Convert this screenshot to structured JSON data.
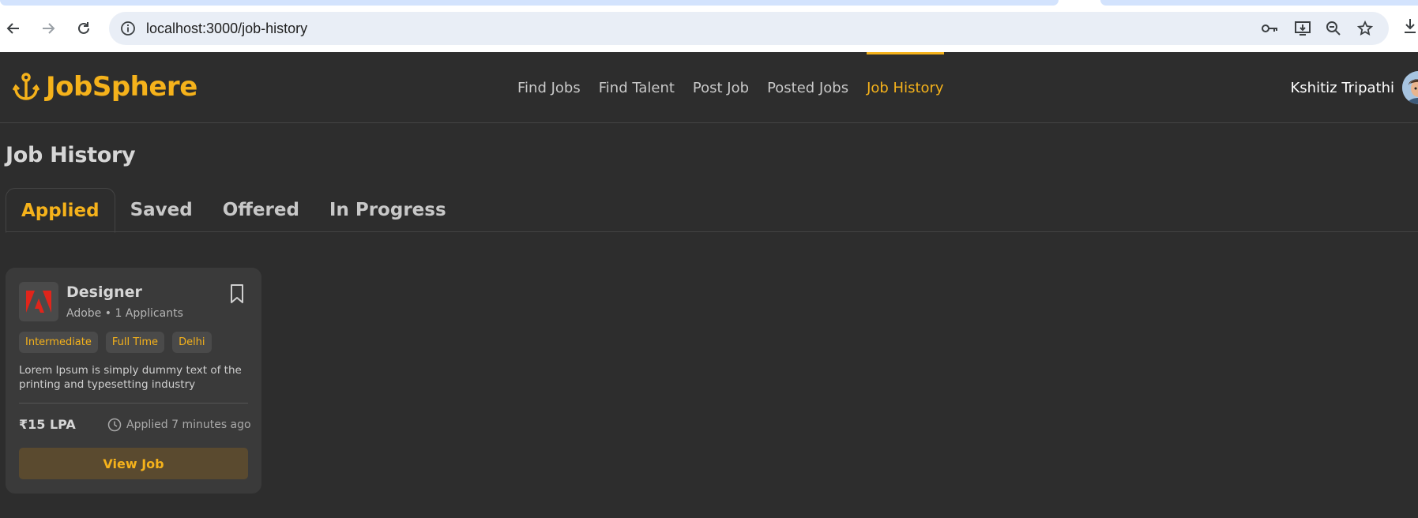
{
  "browser": {
    "url": "localhost:3000/job-history",
    "icons": [
      "back-arrow-icon",
      "forward-arrow-icon",
      "reload-icon",
      "info-icon",
      "key-icon",
      "install-app-icon",
      "zoom-icon",
      "star-icon",
      "download-icon"
    ]
  },
  "header": {
    "brand": "JobSphere",
    "brand_icon": "anchor-icon",
    "nav": [
      {
        "label": "Find Jobs",
        "active": false
      },
      {
        "label": "Find Talent",
        "active": false
      },
      {
        "label": "Post Job",
        "active": false
      },
      {
        "label": "Posted Jobs",
        "active": false
      },
      {
        "label": "Job History",
        "active": true
      }
    ],
    "user_name": "Kshitiz Tripathi"
  },
  "page": {
    "title": "Job History",
    "tabs": [
      {
        "label": "Applied",
        "active": true
      },
      {
        "label": "Saved",
        "active": false
      },
      {
        "label": "Offered",
        "active": false
      },
      {
        "label": "In Progress",
        "active": false
      }
    ]
  },
  "job_card": {
    "title": "Designer",
    "meta": "Adobe • 1 Applicants",
    "company_logo": "adobe-logo",
    "tags": [
      "Intermediate",
      "Full Time",
      "Delhi"
    ],
    "description": "Lorem Ipsum is simply dummy text of the printing and typesetting industry",
    "salary": "₹15 LPA",
    "applied_time": "Applied 7 minutes ago",
    "view_button": "View Job"
  },
  "colors": {
    "accent": "#f5b21b",
    "background": "#2d2d2d",
    "card": "#3a3a3a",
    "button_bg": "#5a4a2f"
  }
}
